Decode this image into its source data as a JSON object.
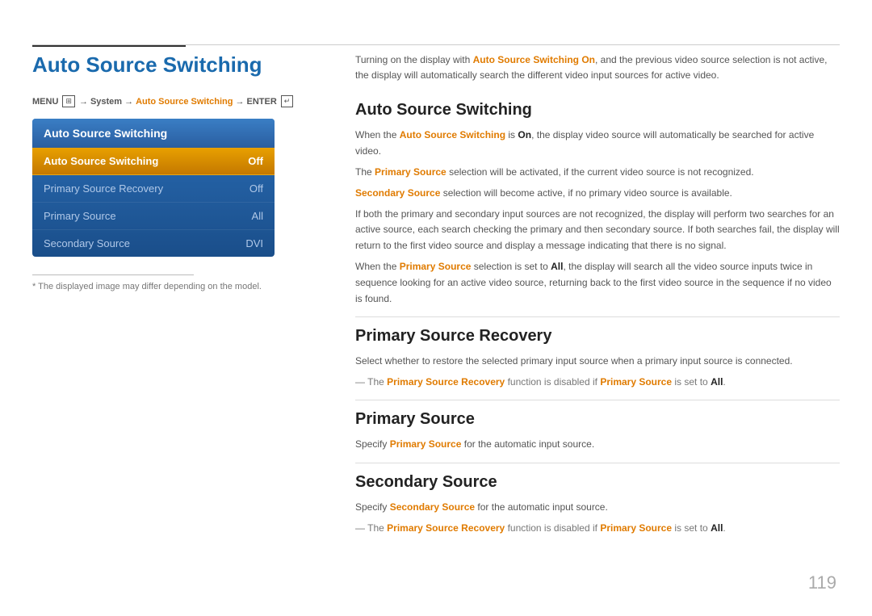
{
  "page": {
    "title": "Auto Source Switching",
    "page_number": "119",
    "footnote": "* The displayed image may differ depending on the model."
  },
  "menu_path": {
    "menu_label": "MENU",
    "arrow1": "→",
    "system": "System",
    "arrow2": "→",
    "auto_source": "Auto Source Switching",
    "arrow3": "→",
    "enter": "ENTER"
  },
  "menu_box": {
    "title": "Auto Source Switching",
    "items": [
      {
        "label": "Auto Source Switching",
        "value": "Off",
        "active": true
      },
      {
        "label": "Primary Source Recovery",
        "value": "Off",
        "active": false
      },
      {
        "label": "Primary Source",
        "value": "All",
        "active": false
      },
      {
        "label": "Secondary Source",
        "value": "DVI",
        "active": false
      }
    ]
  },
  "intro": "Turning on the display with Auto Source Switching On, and the previous video source selection is not active, the display will automatically search the different video input sources for active video.",
  "sections": [
    {
      "id": "auto-source-switching",
      "title": "Auto Source Switching",
      "paragraphs": [
        "When the Auto Source Switching is On, the display video source will automatically be searched for active video.",
        "The Primary Source selection will be activated, if the current video source is not recognized.",
        "Secondary Source selection will become active, if no primary video source is available.",
        "If both the primary and secondary input sources are not recognized, the display will perform two searches for an active source, each search checking the primary and then secondary source. If both searches fail, the display will return to the first video source and display a message indicating that there is no signal.",
        "When the Primary Source selection is set to All, the display will search all the video source inputs twice in sequence looking for an active video source, returning back to the first video source in the sequence if no video is found."
      ]
    },
    {
      "id": "primary-source-recovery",
      "title": "Primary Source Recovery",
      "paragraphs": [
        "Select whether to restore the selected primary input source when a primary input source is connected.",
        "— The Primary Source Recovery function is disabled if Primary Source is set to All."
      ]
    },
    {
      "id": "primary-source",
      "title": "Primary Source",
      "paragraphs": [
        "Specify Primary Source for the automatic input source."
      ]
    },
    {
      "id": "secondary-source",
      "title": "Secondary Source",
      "paragraphs": [
        "Specify Secondary Source for the automatic input source.",
        "— The Primary Source Recovery function is disabled if Primary Source is set to All."
      ]
    }
  ]
}
